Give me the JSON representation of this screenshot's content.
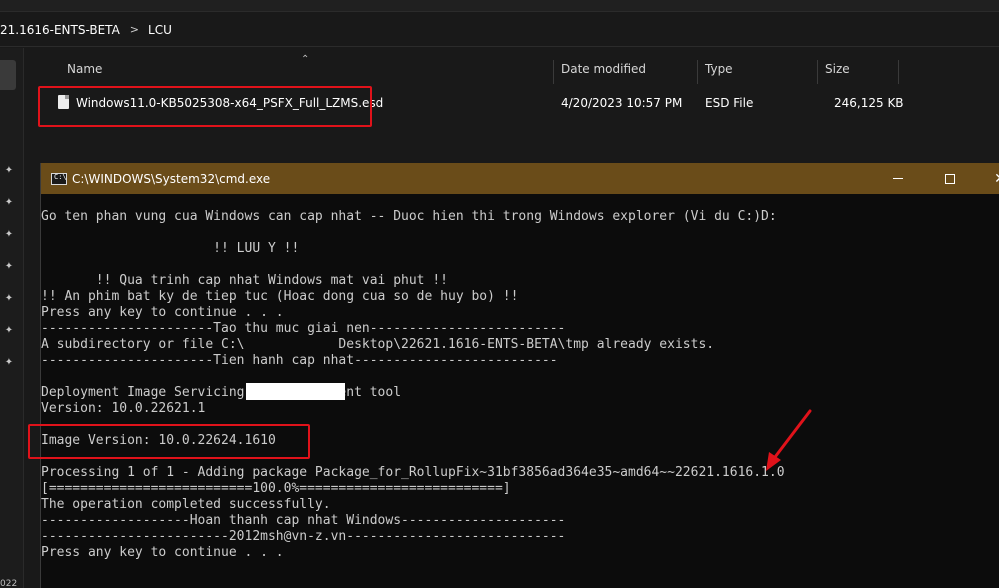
{
  "breadcrumb": [
    "21.1616-ENTS-BETA",
    "LCU"
  ],
  "breadcrumb_separator": ">",
  "file_list": {
    "columns": [
      "Name",
      "Date modified",
      "Type",
      "Size"
    ],
    "rows": [
      {
        "name": "Windows11.0-KB5025308-x64_PSFX_Full_LZMS.esd",
        "date_modified": "4/20/2023 10:57 PM",
        "type": "ESD File",
        "size": "246,125 KB"
      }
    ]
  },
  "nav": {
    "year_fragment": "022"
  },
  "cmd": {
    "title": "C:\\WINDOWS\\System32\\cmd.exe",
    "icon_text": "C:\\",
    "lines": [
      "Go ten phan vung cua Windows can cap nhat -- Duoc hien thi trong Windows explorer (Vi du C:)D:",
      "",
      "                      !! LUU Y !!",
      "",
      "       !! Qua trinh cap nhat Windows mat vai phut !!",
      "!! An phim bat ky de tiep tuc (Hoac dong cua so de huy bo) !!",
      "Press any key to continue . . .",
      "----------------------Tao thu muc giai nen-------------------------",
      "A subdirectory or file C:\\            Desktop\\22621.1616-ENTS-BETA\\tmp already exists.",
      "----------------------Tien hanh cap nhat--------------------------",
      "",
      "Deployment Image Servicing and Management tool",
      "Version: 10.0.22621.1",
      "",
      "Image Version: 10.0.22624.1610",
      "",
      "Processing 1 of 1 - Adding package Package_for_RollupFix~31bf3856ad364e35~amd64~~22621.1616.1.0",
      "[==========================100.0%==========================]",
      "The operation completed successfully.",
      "-------------------Hoan thanh cap nhat Windows---------------------",
      "------------------------2012msh@vn-z.vn----------------------------",
      "Press any key to continue . . ."
    ]
  },
  "colors": {
    "annotation_red": "#e0121a",
    "cmd_titlebar": "#6a4c19",
    "console_text": "#cccccc",
    "explorer_bg": "#191919"
  },
  "icons": [
    "file-icon",
    "cmd-icon",
    "minimize-icon",
    "maximize-icon",
    "close-icon",
    "pin-icon",
    "sort-up-icon",
    "annotation-arrow-icon"
  ]
}
